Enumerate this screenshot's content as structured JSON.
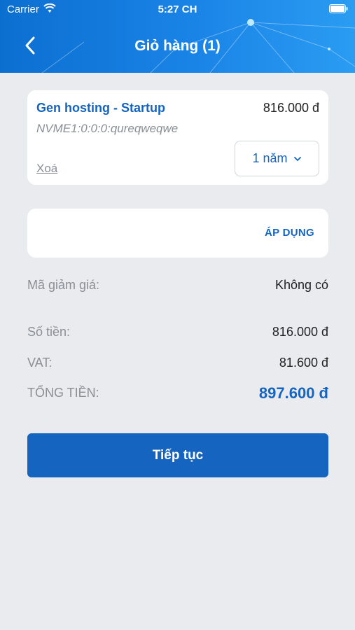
{
  "status_bar": {
    "carrier": "Carrier",
    "time": "5:27 CH"
  },
  "header": {
    "title": "Giỏ hàng (1)",
    "back_icon": "chevron-left-icon"
  },
  "cart_item": {
    "name": "Gen hosting - Startup",
    "price": "816.000 đ",
    "domain": "NVME1:0:0:0:qureqweqwe",
    "remove_label": "Xoá",
    "period": "1 năm"
  },
  "coupon": {
    "input_value": "",
    "placeholder": "",
    "apply_label": "ÁP DỤNG"
  },
  "summary": {
    "discount_label": "Mã giảm giá:",
    "discount_value": "Không có",
    "subtotal_label": "Số tiền:",
    "subtotal_value": "816.000 đ",
    "vat_label": "VAT:",
    "vat_value": "81.600 đ",
    "total_label": "TỔNG TIỀN:",
    "total_value": "897.600 đ"
  },
  "continue_label": "Tiếp tục",
  "colors": {
    "accent": "#1565c0",
    "background": "#e9ebee",
    "header": "#1a84e6"
  }
}
